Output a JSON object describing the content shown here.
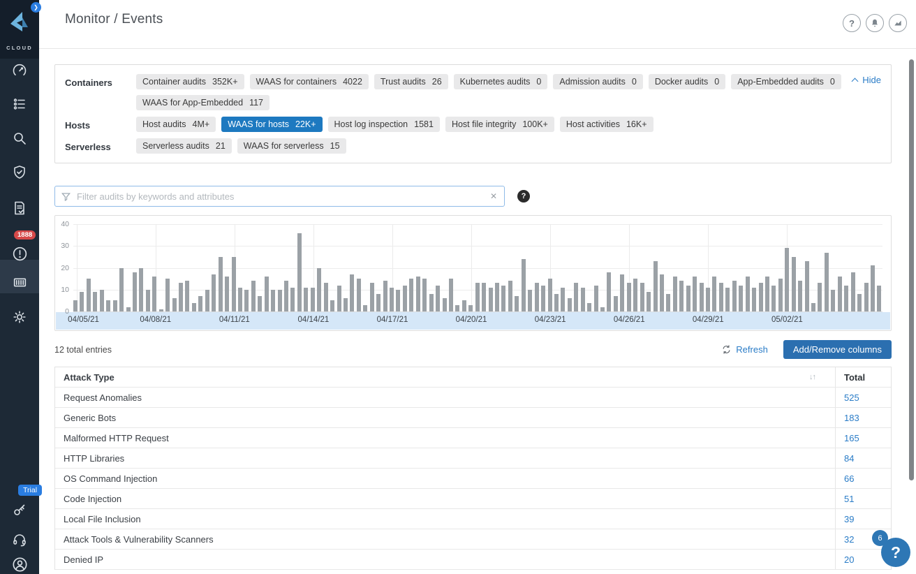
{
  "sidebar": {
    "logo_text": "CLOUD",
    "alerts_badge": "1888",
    "trial_badge": "Trial",
    "icons": [
      "chevron-right",
      "gauge",
      "policy-list",
      "search",
      "shield-check",
      "compliance-doc",
      "alert-circle",
      "container",
      "gear",
      "key",
      "headset",
      "user"
    ]
  },
  "header": {
    "title": "Monitor / Events",
    "icons": [
      "help",
      "notifications",
      "usage-chart"
    ]
  },
  "categories": {
    "hide_label": "Hide",
    "rows": [
      {
        "label": "Containers",
        "chips": [
          {
            "label": "Container audits",
            "count": "352K+",
            "selected": false
          },
          {
            "label": "WAAS for containers",
            "count": "4022",
            "selected": false
          },
          {
            "label": "Trust audits",
            "count": "26",
            "selected": false
          },
          {
            "label": "Kubernetes audits",
            "count": "0",
            "selected": false
          },
          {
            "label": "Admission audits",
            "count": "0",
            "selected": false
          },
          {
            "label": "Docker audits",
            "count": "0",
            "selected": false
          },
          {
            "label": "App-Embedded audits",
            "count": "0",
            "selected": false
          },
          {
            "label": "WAAS for App-Embedded",
            "count": "117",
            "selected": false
          }
        ]
      },
      {
        "label": "Hosts",
        "chips": [
          {
            "label": "Host audits",
            "count": "4M+",
            "selected": false
          },
          {
            "label": "WAAS for hosts",
            "count": "22K+",
            "selected": true
          },
          {
            "label": "Host log inspection",
            "count": "1581",
            "selected": false
          },
          {
            "label": "Host file integrity",
            "count": "100K+",
            "selected": false
          },
          {
            "label": "Host activities",
            "count": "16K+",
            "selected": false
          }
        ]
      },
      {
        "label": "Serverless",
        "chips": [
          {
            "label": "Serverless audits",
            "count": "21",
            "selected": false
          },
          {
            "label": "WAAS for serverless",
            "count": "15",
            "selected": false
          }
        ]
      }
    ]
  },
  "filter": {
    "placeholder": "Filter audits by keywords and attributes"
  },
  "chart_data": {
    "type": "bar",
    "title": "",
    "xlabel": "",
    "ylabel": "",
    "ylim": [
      0,
      40
    ],
    "yticks": [
      0,
      10,
      20,
      30,
      40
    ],
    "x_tick_labels": [
      "04/05/21",
      "04/08/21",
      "04/11/21",
      "04/14/21",
      "04/17/21",
      "04/20/21",
      "04/23/21",
      "04/26/21",
      "04/29/21",
      "05/02/21"
    ],
    "ticks_every_n_bars": 12,
    "grid": true,
    "bar_color": "#9ba1a6",
    "band_color": "#d5e7f8",
    "values": [
      5,
      9,
      15,
      9,
      10,
      5,
      5,
      20,
      2,
      18,
      20,
      10,
      16,
      1,
      15,
      6,
      13,
      14,
      4,
      7,
      10,
      17,
      25,
      16,
      25,
      11,
      10,
      14,
      7,
      16,
      10,
      10,
      14,
      11,
      36,
      11,
      11,
      20,
      13,
      5,
      12,
      6,
      17,
      15,
      3,
      13,
      8,
      14,
      11,
      10,
      12,
      15,
      16,
      15,
      8,
      12,
      6,
      15,
      3,
      5,
      3,
      13,
      13,
      11,
      13,
      12,
      14,
      7,
      24,
      10,
      13,
      12,
      15,
      8,
      11,
      6,
      13,
      11,
      4,
      12,
      2,
      18,
      7,
      17,
      13,
      15,
      13,
      9,
      23,
      17,
      8,
      16,
      14,
      12,
      16,
      13,
      11,
      16,
      13,
      11,
      14,
      12,
      16,
      11,
      13,
      16,
      12,
      15,
      29,
      25,
      14,
      23,
      4,
      13,
      27,
      10,
      16,
      12,
      18,
      8,
      13,
      21,
      12
    ]
  },
  "table": {
    "total_entries_label": "12 total entries",
    "refresh_label": "Refresh",
    "add_remove_label": "Add/Remove columns",
    "columns": [
      "Attack Type",
      "Total"
    ],
    "rows": [
      {
        "attack_type": "Request Anomalies",
        "total": "525"
      },
      {
        "attack_type": "Generic Bots",
        "total": "183"
      },
      {
        "attack_type": "Malformed HTTP Request",
        "total": "165"
      },
      {
        "attack_type": "HTTP Libraries",
        "total": "84"
      },
      {
        "attack_type": "OS Command Injection",
        "total": "66"
      },
      {
        "attack_type": "Code Injection",
        "total": "51"
      },
      {
        "attack_type": "Local File Inclusion",
        "total": "39"
      },
      {
        "attack_type": "Attack Tools & Vulnerability Scanners",
        "total": "32"
      },
      {
        "attack_type": "Denied IP",
        "total": "20"
      }
    ]
  },
  "fab": {
    "label": "?",
    "badge": "6"
  },
  "colors": {
    "accent_blue": "#2a7cc7",
    "selected_chip": "#1d79c0",
    "sidebar_bg": "#1d2936",
    "alert_red": "#d64949",
    "bar_gray": "#9ba1a6",
    "band_blue": "#d5e7f8"
  }
}
